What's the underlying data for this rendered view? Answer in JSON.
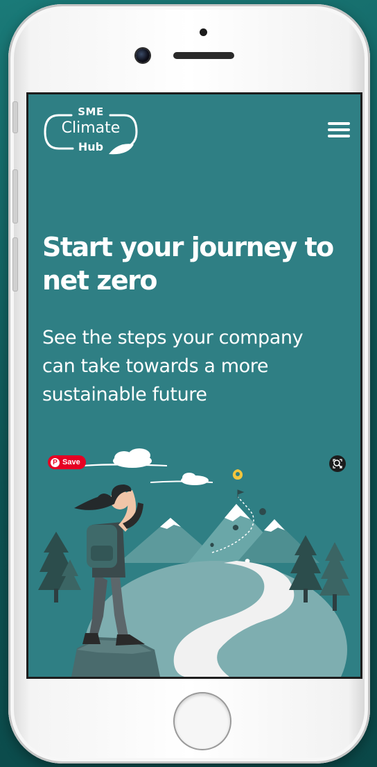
{
  "logo": {
    "line1": "SME",
    "line2": "Climate",
    "line3": "Hub"
  },
  "hero": {
    "headline_line1": "Start your journey to",
    "headline_line2": "net zero",
    "subhead_line1": "See the steps your company",
    "subhead_line2": "can take towards a more",
    "subhead_line3": "sustainable future"
  },
  "overlay": {
    "save_label": "Save"
  },
  "icons": {
    "menu": "hamburger-menu-icon",
    "pin": "pinterest-icon",
    "lens": "visual-search-icon"
  },
  "colors": {
    "screen_bg": "#2f7f84",
    "pin_yellow": "#f2c53d",
    "pinterest_red": "#e60023"
  }
}
